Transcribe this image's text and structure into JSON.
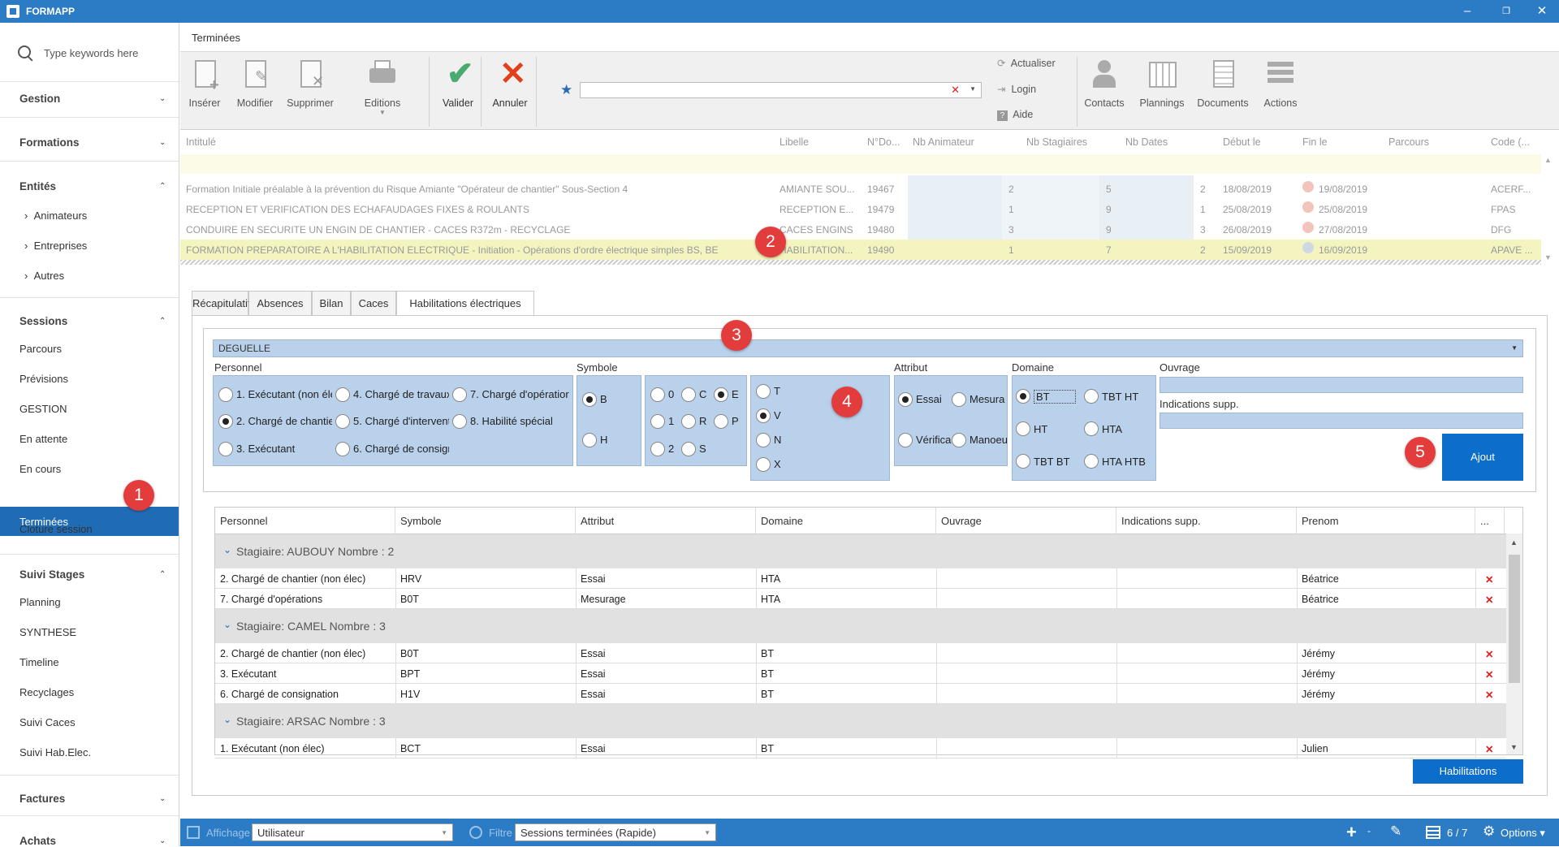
{
  "app": {
    "title": "FORMAPP"
  },
  "sidebar": {
    "search_placeholder": "Type keywords here",
    "groups": {
      "gestion": "Gestion",
      "formations": "Formations",
      "entites": "Entités",
      "sessions": "Sessions",
      "suivi": "Suivi Stages",
      "factures": "Factures",
      "achats": "Achats"
    },
    "entites_items": [
      "Animateurs",
      "Entreprises",
      "Autres"
    ],
    "sessions_items": [
      "Parcours",
      "Prévisions",
      "GESTION",
      "En attente",
      "En cours",
      "Terminées",
      "Cloture session"
    ],
    "suivi_items": [
      "Planning",
      "SYNTHESE",
      "Timeline",
      "Recyclages",
      "Suivi Caces",
      "Suivi Hab.Elec."
    ],
    "active": "Terminées"
  },
  "doc_tab": "Terminées",
  "ribbon": {
    "inserer": "Insérer",
    "modifier": "Modifier",
    "supprimer": "Supprimer",
    "editions": "Editions",
    "valider": "Valider",
    "annuler": "Annuler",
    "actualiser": "Actualiser",
    "login": "Login",
    "aide": "Aide",
    "contacts": "Contacts",
    "plannings": "Plannings",
    "documents": "Documents",
    "actions": "Actions"
  },
  "grid": {
    "headers": [
      "Intitulé",
      "Libelle",
      "N°Do...",
      "Nb Animateur",
      "Nb Stagiaires",
      "Nb Dates",
      "Début le",
      "Fin le",
      "Parcours",
      "Code (..."
    ],
    "rows": [
      [
        "Formation Initiale préalable à la prévention du Risque Amiante \"Opérateur de chantier\" Sous-Section 4",
        "AMIANTE SOU...",
        "19467",
        "2",
        "5",
        "2",
        "18/08/2019",
        "19/08/2019",
        "",
        "ACERF..."
      ],
      [
        "RECEPTION ET VERIFICATION DES ECHAFAUDAGES FIXES & ROULANTS",
        "RECEPTION E...",
        "19479",
        "1",
        "9",
        "1",
        "25/08/2019",
        "25/08/2019",
        "",
        "FPAS"
      ],
      [
        "CONDUIRE EN SECURITE UN ENGIN DE CHANTIER - CACES R372m - RECYCLAGE",
        "CACES ENGINS",
        "19480",
        "3",
        "9",
        "3",
        "26/08/2019",
        "27/08/2019",
        "",
        "DFG"
      ],
      [
        "FORMATION PREPARATOIRE A L'HABILITATION ELECTRIQUE - Initiation - Opérations d'ordre électrique simples BS, BE",
        "HABILITATION...",
        "19490",
        "1",
        "7",
        "2",
        "15/09/2019",
        "16/09/2019",
        "",
        "APAVE ..."
      ]
    ]
  },
  "tabs": [
    "Récapitulatif",
    "Absences",
    "Bilan",
    "Caces",
    "Habilitations électriques"
  ],
  "form": {
    "stagiaire": "DEGUELLE",
    "personnel_label": "Personnel",
    "personnel": [
      "1. Exécutant (non éle",
      "4. Chargé de travaux",
      "7. Chargé d'opératior",
      "2. Chargé de chantier",
      "5. Chargé d'intervent",
      "8. Habilité spécial",
      "3. Exécutant",
      "6. Chargé de consign"
    ],
    "symbole_label": "Symbole",
    "symbole1": [
      "B",
      "H"
    ],
    "symbole2": [
      "0",
      "C",
      "E",
      "1",
      "R",
      "P",
      "2",
      "S"
    ],
    "symbole3": [
      "T",
      "V",
      "N",
      "X"
    ],
    "attribut_label": "Attribut",
    "attribut": [
      "Essai",
      "Mesura",
      "Vérifica",
      "Manoeu"
    ],
    "domaine_label": "Domaine",
    "domaine": [
      "BT",
      "TBT HT",
      "HT",
      "HTA",
      "TBT BT",
      "HTA HTB"
    ],
    "ouvrage_label": "Ouvrage",
    "indications_label": "Indications supp.",
    "ajout": "Ajout"
  },
  "table": {
    "headers": [
      "Personnel",
      "Symbole",
      "Attribut",
      "Domaine",
      "Ouvrage",
      "Indications supp.",
      "Prenom",
      "..."
    ],
    "groups": [
      {
        "title": "Stagiaire: AUBOUY Nombre : 2",
        "rows": [
          [
            "2. Chargé de chantier (non élec)",
            "HRV",
            "Essai",
            "HTA",
            "",
            "",
            "Béatrice"
          ],
          [
            "7. Chargé d'opérations",
            "B0T",
            "Mesurage",
            "HTA",
            "",
            "",
            "Béatrice"
          ]
        ]
      },
      {
        "title": "Stagiaire: CAMEL Nombre : 3",
        "rows": [
          [
            "2. Chargé de chantier (non élec)",
            "B0T",
            "Essai",
            "BT",
            "",
            "",
            "Jérémy"
          ],
          [
            "3. Exécutant",
            "BPT",
            "Essai",
            "BT",
            "",
            "",
            "Jérémy"
          ],
          [
            "6. Chargé de consignation",
            "H1V",
            "Essai",
            "BT",
            "",
            "",
            "Jérémy"
          ]
        ]
      },
      {
        "title": "Stagiaire: ARSAC Nombre : 3",
        "rows": [
          [
            "1. Exécutant (non élec)",
            "BCT",
            "Essai",
            "BT",
            "",
            "",
            "Julien"
          ]
        ]
      }
    ]
  },
  "habilitations_btn": "Habilitations",
  "status": {
    "affichage": "Affichage",
    "affichage_val": "Utilisateur",
    "filtre": "Filtre",
    "filtre_val": "Sessions terminées (Rapide)",
    "pages": "6 / 7",
    "options": "Options"
  },
  "badges": [
    "1",
    "2",
    "3",
    "4",
    "5"
  ]
}
